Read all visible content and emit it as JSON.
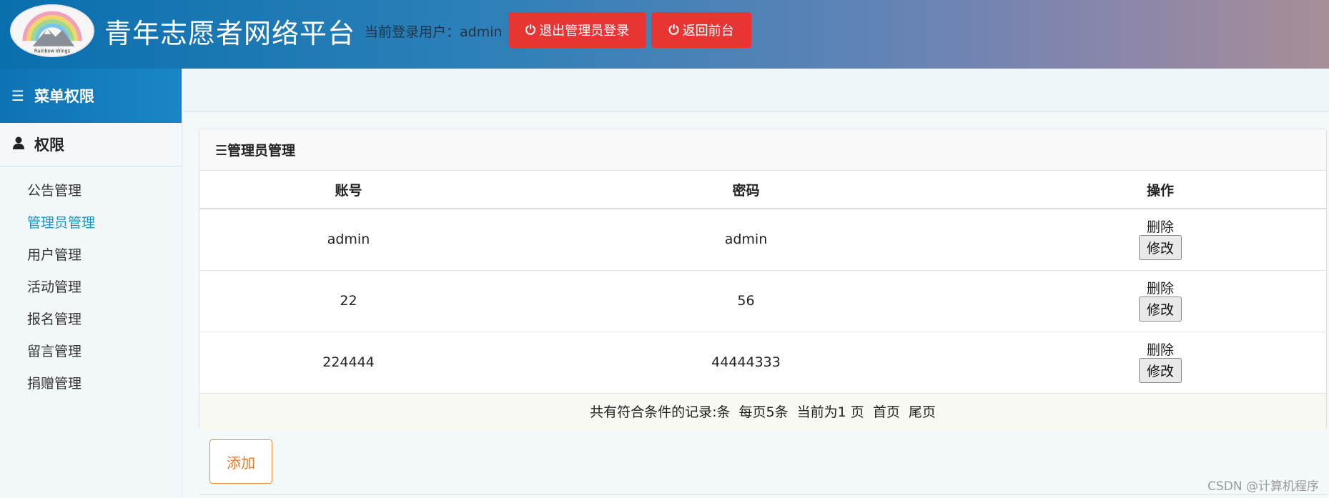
{
  "header": {
    "logo_text": "Rainbow Wings",
    "title": "青年志愿者网络平台",
    "login_label": "当前登录用户：",
    "login_user": "admin",
    "logout_button": "退出管理员登录",
    "front_button": "返回前台"
  },
  "sidebar": {
    "heading": "菜单权限",
    "group": "权限",
    "items": [
      {
        "label": "公告管理"
      },
      {
        "label": "管理员管理",
        "active": true
      },
      {
        "label": "用户管理"
      },
      {
        "label": "活动管理"
      },
      {
        "label": "报名管理"
      },
      {
        "label": "留言管理"
      },
      {
        "label": "捐赠管理"
      }
    ]
  },
  "panel": {
    "title": "☰管理员管理",
    "columns": [
      "账号",
      "密码",
      "操作"
    ],
    "rows": [
      {
        "account": "admin",
        "password": "admin",
        "delete": "删除",
        "edit": "修改"
      },
      {
        "account": "22",
        "password": "56",
        "delete": "删除",
        "edit": "修改"
      },
      {
        "account": "224444",
        "password": "44444333",
        "delete": "删除",
        "edit": "修改"
      }
    ],
    "pager": {
      "total": "共有符合条件的记录:条",
      "per_page": "每页5条",
      "current": "当前为1 页",
      "first": "首页",
      "last": "尾页"
    }
  },
  "add_button": "添加",
  "watermark": "CSDN @计算机程序",
  "colors": {
    "header_start": "#0a6fae",
    "header_end": "#a88e98",
    "danger": "#e93434",
    "active_menu": "#1a93c9",
    "add_button": "#ef7a22"
  }
}
